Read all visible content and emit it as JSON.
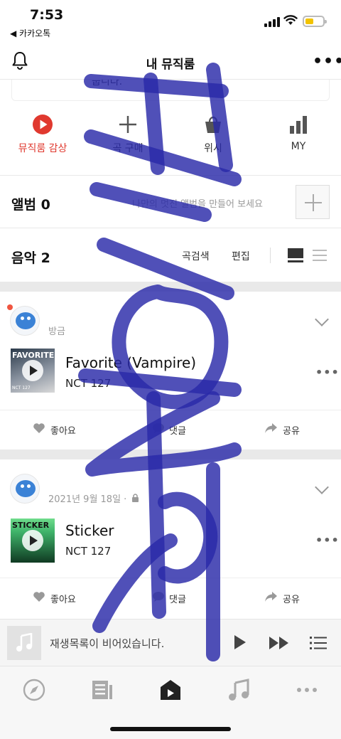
{
  "status_bar": {
    "time": "7:53",
    "back_app": "◀ 카카오톡"
  },
  "header": {
    "title": "내 뮤직룸"
  },
  "description_fragment": "줍니다.",
  "actions": [
    {
      "label": "뮤직룸 감상",
      "icon": "play-circle-icon"
    },
    {
      "label": "곡 구매",
      "icon": "plus-icon"
    },
    {
      "label": "위시",
      "icon": "shopping-bag-icon"
    },
    {
      "label": "MY",
      "icon": "bar-chart-icon"
    }
  ],
  "album": {
    "heading": "앨범 0",
    "hint": "나만의 멋진 앨범을 만들어 보세요"
  },
  "music": {
    "heading": "음악 2",
    "search_label": "곡검색",
    "edit_label": "편집"
  },
  "posts": [
    {
      "time": "방금",
      "cover_text": "FAVORITE",
      "cover_sub": "NCT 127",
      "title": "Favorite (Vampire)",
      "artist": "NCT 127",
      "like_label": "좋아요",
      "comment_label": "댓글",
      "share_label": "공유"
    },
    {
      "time": "2021년 9월 18일 ·",
      "cover_text": "STICKER",
      "cover_sub": "",
      "title": "Sticker",
      "artist": "NCT 127",
      "like_label": "좋아요",
      "comment_label": "댓글",
      "share_label": "공유"
    }
  ],
  "player": {
    "message": "재생목록이 비어있습니다."
  },
  "tabs": [
    "compass-icon",
    "feed-icon",
    "musicroom-icon",
    "music-note-icon",
    "more-icon"
  ],
  "colors": {
    "accent_red": "#e0392f",
    "scribble": "#2a2aa8"
  }
}
